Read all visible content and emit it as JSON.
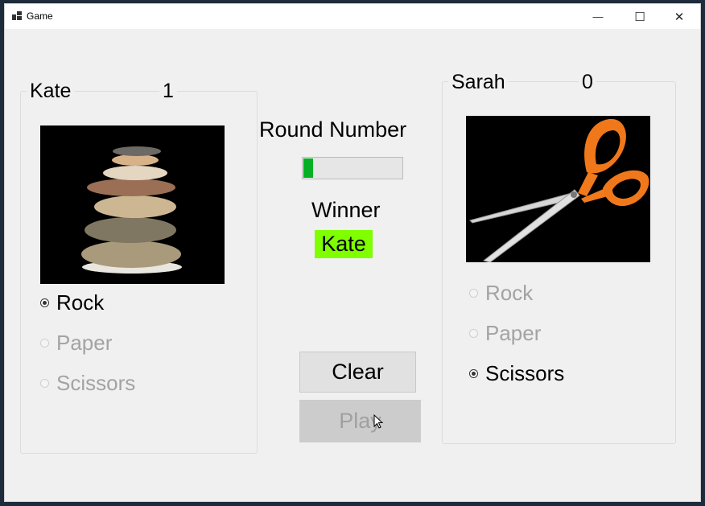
{
  "window": {
    "title": "Game",
    "minimize_glyph": "—",
    "maximize_glyph": "☐",
    "close_glyph": "✕"
  },
  "player1": {
    "name": "Kate",
    "score": "1",
    "picture_icon": "rock-stack-image",
    "options": [
      {
        "label": "Rock",
        "checked": true,
        "enabled": true
      },
      {
        "label": "Paper",
        "checked": false,
        "enabled": false
      },
      {
        "label": "Scissors",
        "checked": false,
        "enabled": false
      }
    ]
  },
  "player2": {
    "name": "Sarah",
    "score": "0",
    "picture_icon": "scissors-image",
    "options": [
      {
        "label": "Rock",
        "checked": false,
        "enabled": false
      },
      {
        "label": "Paper",
        "checked": false,
        "enabled": false
      },
      {
        "label": "Scissors",
        "checked": true,
        "enabled": true
      }
    ]
  },
  "center": {
    "round_label": "Round Number",
    "round_progress_percent": 10,
    "winner_label": "Winner",
    "winner_value": "Kate",
    "winner_color": "#7fff00",
    "progress_color": "#06b025"
  },
  "buttons": {
    "clear_label": "Clear",
    "play_label": "Play"
  }
}
